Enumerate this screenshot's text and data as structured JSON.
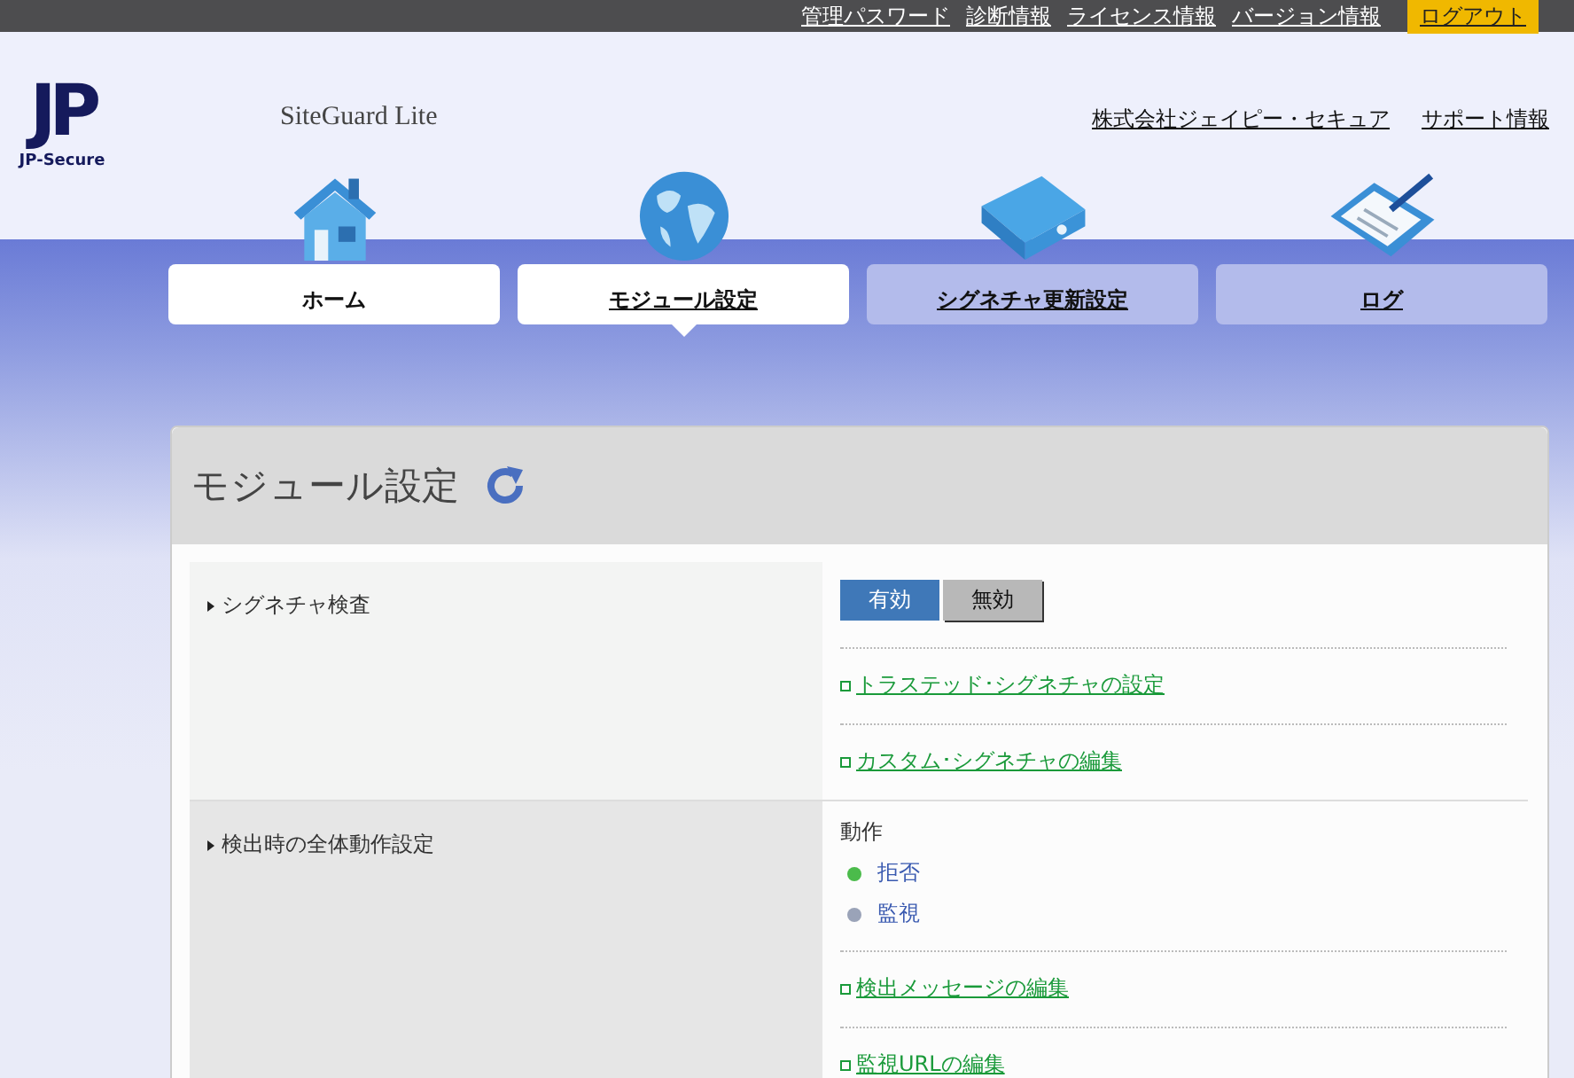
{
  "top_links": [
    {
      "label": "管理パスワード"
    },
    {
      "label": "診断情報"
    },
    {
      "label": "ライセンス情報"
    },
    {
      "label": "バージョン情報"
    }
  ],
  "logout": "ログアウト",
  "logo": {
    "mark": "JP",
    "name": "JP-Secure"
  },
  "product": "SiteGuard Lite",
  "header_links": [
    {
      "label": "株式会社ジェイピー・セキュア"
    },
    {
      "label": "サポート情報"
    }
  ],
  "tabs": [
    {
      "label": "ホーム",
      "selected": false,
      "highlighted": true
    },
    {
      "label": "モジュール設定",
      "selected": true,
      "highlighted": true
    },
    {
      "label": "シグネチャ更新設定",
      "selected": false,
      "highlighted": false
    },
    {
      "label": "ログ",
      "selected": false,
      "highlighted": false
    }
  ],
  "panel": {
    "title": "モジュール設定",
    "sections": [
      {
        "kind": "toggle",
        "label": "シグネチャ検査",
        "options": [
          {
            "label": "有効",
            "selected": true
          },
          {
            "label": "無効",
            "selected": false
          }
        ],
        "links": [
          {
            "label": "トラステッド･シグネチャの設定"
          },
          {
            "label": "カスタム･シグネチャの編集"
          }
        ]
      },
      {
        "kind": "radio",
        "label": "検出時の全体動作設定",
        "heading": "動作",
        "options": [
          {
            "label": "拒否",
            "selected": true
          },
          {
            "label": "監視",
            "selected": false
          }
        ],
        "links": [
          {
            "label": "検出メッセージの編集"
          },
          {
            "label": "監視URLの編集"
          }
        ]
      }
    ]
  }
}
